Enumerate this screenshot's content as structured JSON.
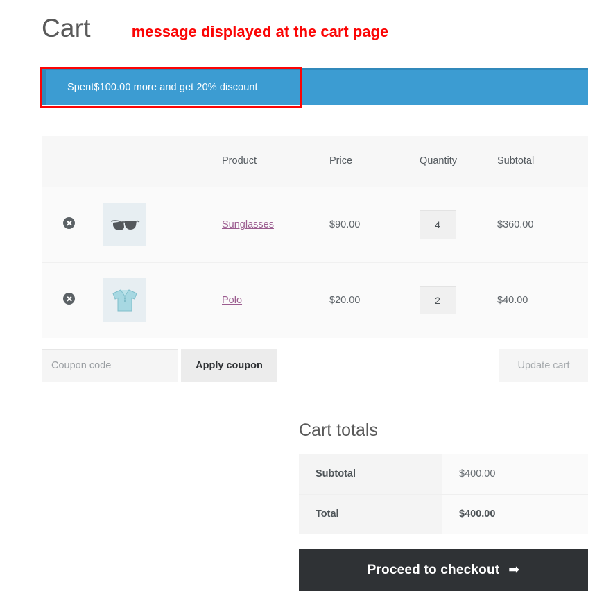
{
  "page": {
    "title": "Cart",
    "annotation": "message displayed at the cart page"
  },
  "notice": {
    "message": "Spent$100.00 more and get 20% discount",
    "background_color": "#3c9cd2",
    "border_color": "#3189bb"
  },
  "annotation_box": {
    "color": "#fb0505"
  },
  "cart_table": {
    "headers": {
      "remove": "",
      "thumbnail": "",
      "product": "Product",
      "price": "Price",
      "quantity": "Quantity",
      "subtotal": "Subtotal"
    },
    "rows": [
      {
        "remove_label": "Remove this item",
        "thumbnail_icon": "sunglasses-image",
        "name": "Sunglasses",
        "price": "$90.00",
        "quantity": "4",
        "subtotal": "$360.00"
      },
      {
        "remove_label": "Remove this item",
        "thumbnail_icon": "polo-shirt-image",
        "name": "Polo",
        "price": "$20.00",
        "quantity": "2",
        "subtotal": "$40.00"
      }
    ]
  },
  "actions": {
    "coupon_placeholder": "Coupon code",
    "coupon_value": "",
    "apply_coupon_label": "Apply coupon",
    "update_cart_label": "Update cart"
  },
  "totals": {
    "heading": "Cart totals",
    "rows": [
      {
        "label": "Subtotal",
        "value": "$400.00"
      },
      {
        "label": "Total",
        "value": "$400.00"
      }
    ],
    "checkout_label": "Proceed to checkout",
    "checkout_arrow": "➡"
  }
}
